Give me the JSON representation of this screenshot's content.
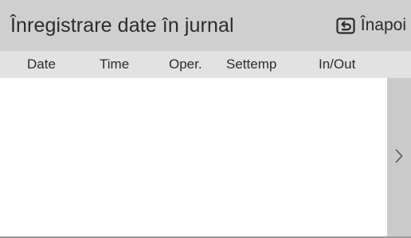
{
  "header": {
    "title": "Înregistrare date în jurnal",
    "back_label": "Înapoi",
    "back_icon": "return-icon"
  },
  "table": {
    "columns": [
      {
        "label": "Date"
      },
      {
        "label": "Time"
      },
      {
        "label": "Oper."
      },
      {
        "label": "Settemp"
      },
      {
        "label": "In/Out"
      }
    ],
    "rows": []
  },
  "pager": {
    "next_icon": "chevron-right-icon"
  },
  "colors": {
    "header_bg": "#cfcfcf",
    "column_header_bg": "#e2e2e2",
    "scroll_strip_bg": "#cbcbcb",
    "text": "#2b2b2b"
  }
}
